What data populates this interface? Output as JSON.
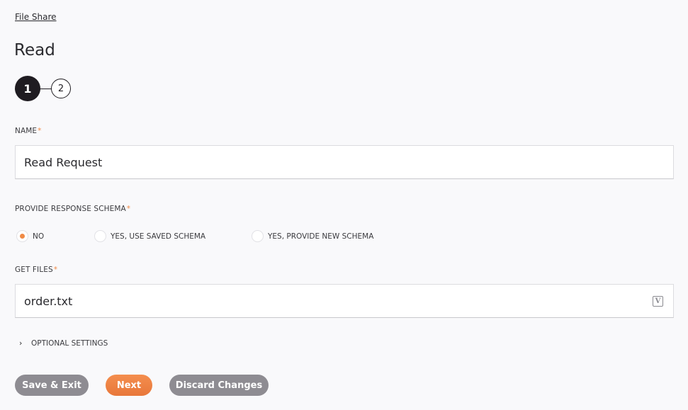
{
  "breadcrumb": {
    "label": "File Share"
  },
  "page": {
    "title": "Read"
  },
  "stepper": {
    "steps": [
      {
        "label": "1",
        "state": "active"
      },
      {
        "label": "2",
        "state": "inactive"
      }
    ]
  },
  "form": {
    "name": {
      "label": "NAME",
      "required_marker": "*",
      "value": "Read Request"
    },
    "response_schema": {
      "label": "PROVIDE RESPONSE SCHEMA",
      "required_marker": "*",
      "options": [
        {
          "label": "NO",
          "selected": true
        },
        {
          "label": "YES, USE SAVED SCHEMA",
          "selected": false
        },
        {
          "label": "YES, PROVIDE NEW SCHEMA",
          "selected": false
        }
      ]
    },
    "get_files": {
      "label": "GET FILES",
      "required_marker": "*",
      "value": "order.txt",
      "variable_icon": "V"
    },
    "optional_settings": {
      "label": "OPTIONAL SETTINGS",
      "expanded": false
    }
  },
  "actions": {
    "save_exit": "Save & Exit",
    "next": "Next",
    "discard": "Discard Changes"
  },
  "colors": {
    "accent": "#f08a46",
    "step_active": "#1f1c21",
    "button_gray": "#8e8c92",
    "background": "#f9f9fb"
  }
}
